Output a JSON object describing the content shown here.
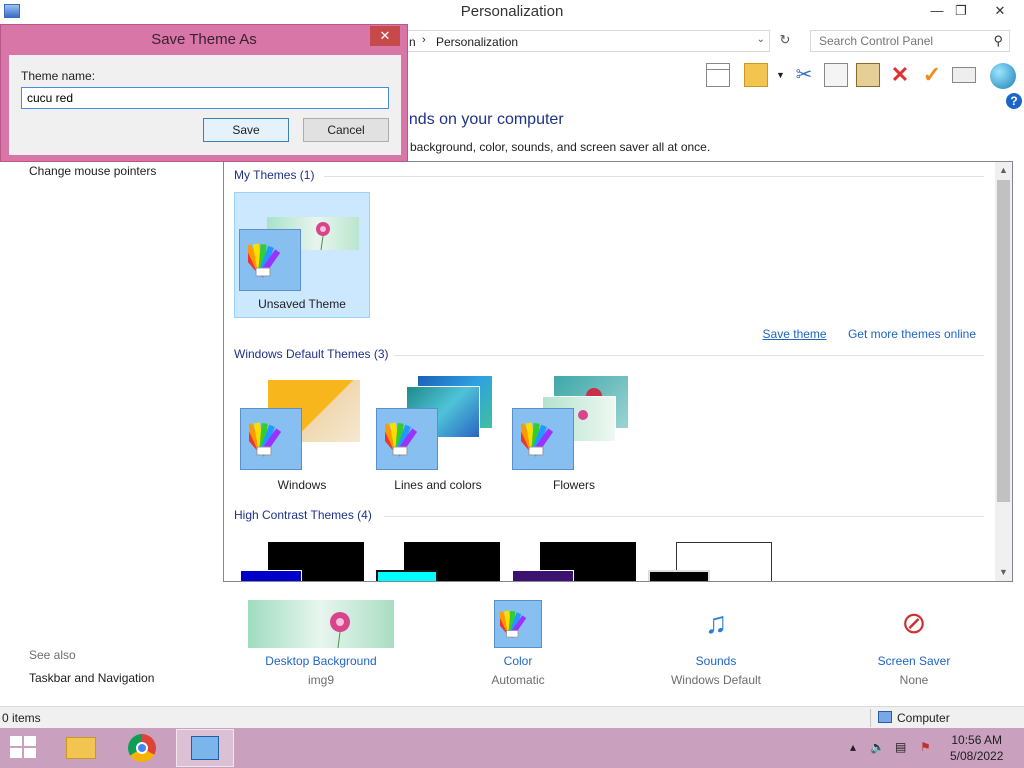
{
  "window": {
    "title": "Personalization",
    "controls": {
      "minimize": "—",
      "maximize": "❐",
      "close": "✕"
    }
  },
  "address": {
    "crumb_partial": "n",
    "separator": "›",
    "current": "Personalization",
    "search_placeholder": "Search Control Panel"
  },
  "main": {
    "heading_partial": "unds on your computer",
    "subheading_partial": "p background, color, sounds, and screen saver all at once."
  },
  "left_nav": {
    "links": [
      "Change mouse pointers"
    ],
    "see_also_title": "See also",
    "see_also_links": [
      "Taskbar and Navigation"
    ]
  },
  "themes": {
    "my_themes_label": "My Themes (1)",
    "my_themes": [
      {
        "name": "Unsaved Theme",
        "selected": true
      }
    ],
    "links": {
      "save_theme": "Save theme",
      "get_more": "Get more themes online"
    },
    "default_label": "Windows Default Themes (3)",
    "default_themes": [
      {
        "name": "Windows"
      },
      {
        "name": "Lines and colors"
      },
      {
        "name": "Flowers"
      }
    ],
    "high_contrast_label": "High Contrast Themes (4)"
  },
  "bottom_bar": {
    "desktop_background": {
      "label": "Desktop Background",
      "value": "img9"
    },
    "color": {
      "label": "Color",
      "value": "Automatic"
    },
    "sounds": {
      "label": "Sounds",
      "value": "Windows Default"
    },
    "screen_saver": {
      "label": "Screen Saver",
      "value": "None"
    }
  },
  "status": {
    "items": "0 items",
    "location": "Computer"
  },
  "taskbar": {
    "time": "10:56 AM",
    "date": "5/08/2022"
  },
  "dialog": {
    "title": "Save Theme As",
    "close": "✕",
    "name_label": "Theme name:",
    "name_value": "cucu red",
    "save_label": "Save",
    "cancel_label": "Cancel"
  },
  "colors": {
    "dialog_frame": "#d976a8",
    "taskbar": "#c9a0bd",
    "link": "#1e64c8",
    "heading": "#1e3287"
  }
}
